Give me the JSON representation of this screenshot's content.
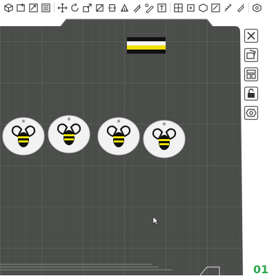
{
  "toolbar": {
    "icons": [
      "add-object-icon",
      "add-plate-icon",
      "auto-orient-icon",
      "arrange-icon",
      "move-icon",
      "rotate-icon",
      "scale-icon",
      "lay-on-face-icon",
      "cut-icon",
      "support-paint-icon",
      "seam-paint-icon",
      "color-paint-icon",
      "split-icon",
      "settings-icon"
    ]
  },
  "plate": {
    "plate_number": "01",
    "objects": [
      {
        "name": "bee-keychain-1"
      },
      {
        "name": "bee-keychain-2"
      },
      {
        "name": "bee-keychain-3"
      },
      {
        "name": "bee-keychain-4"
      },
      {
        "name": "striped-flag-block"
      }
    ]
  },
  "side_panel": {
    "buttons": [
      "close-icon",
      "pick-object-icon",
      "layout-icon",
      "lock-icon",
      "plate-settings-icon"
    ]
  },
  "colors": {
    "plate": "#4b4d4b",
    "grid": "#5e605e",
    "accent": "#2fa84f",
    "bee_yellow": "#f0e000"
  }
}
